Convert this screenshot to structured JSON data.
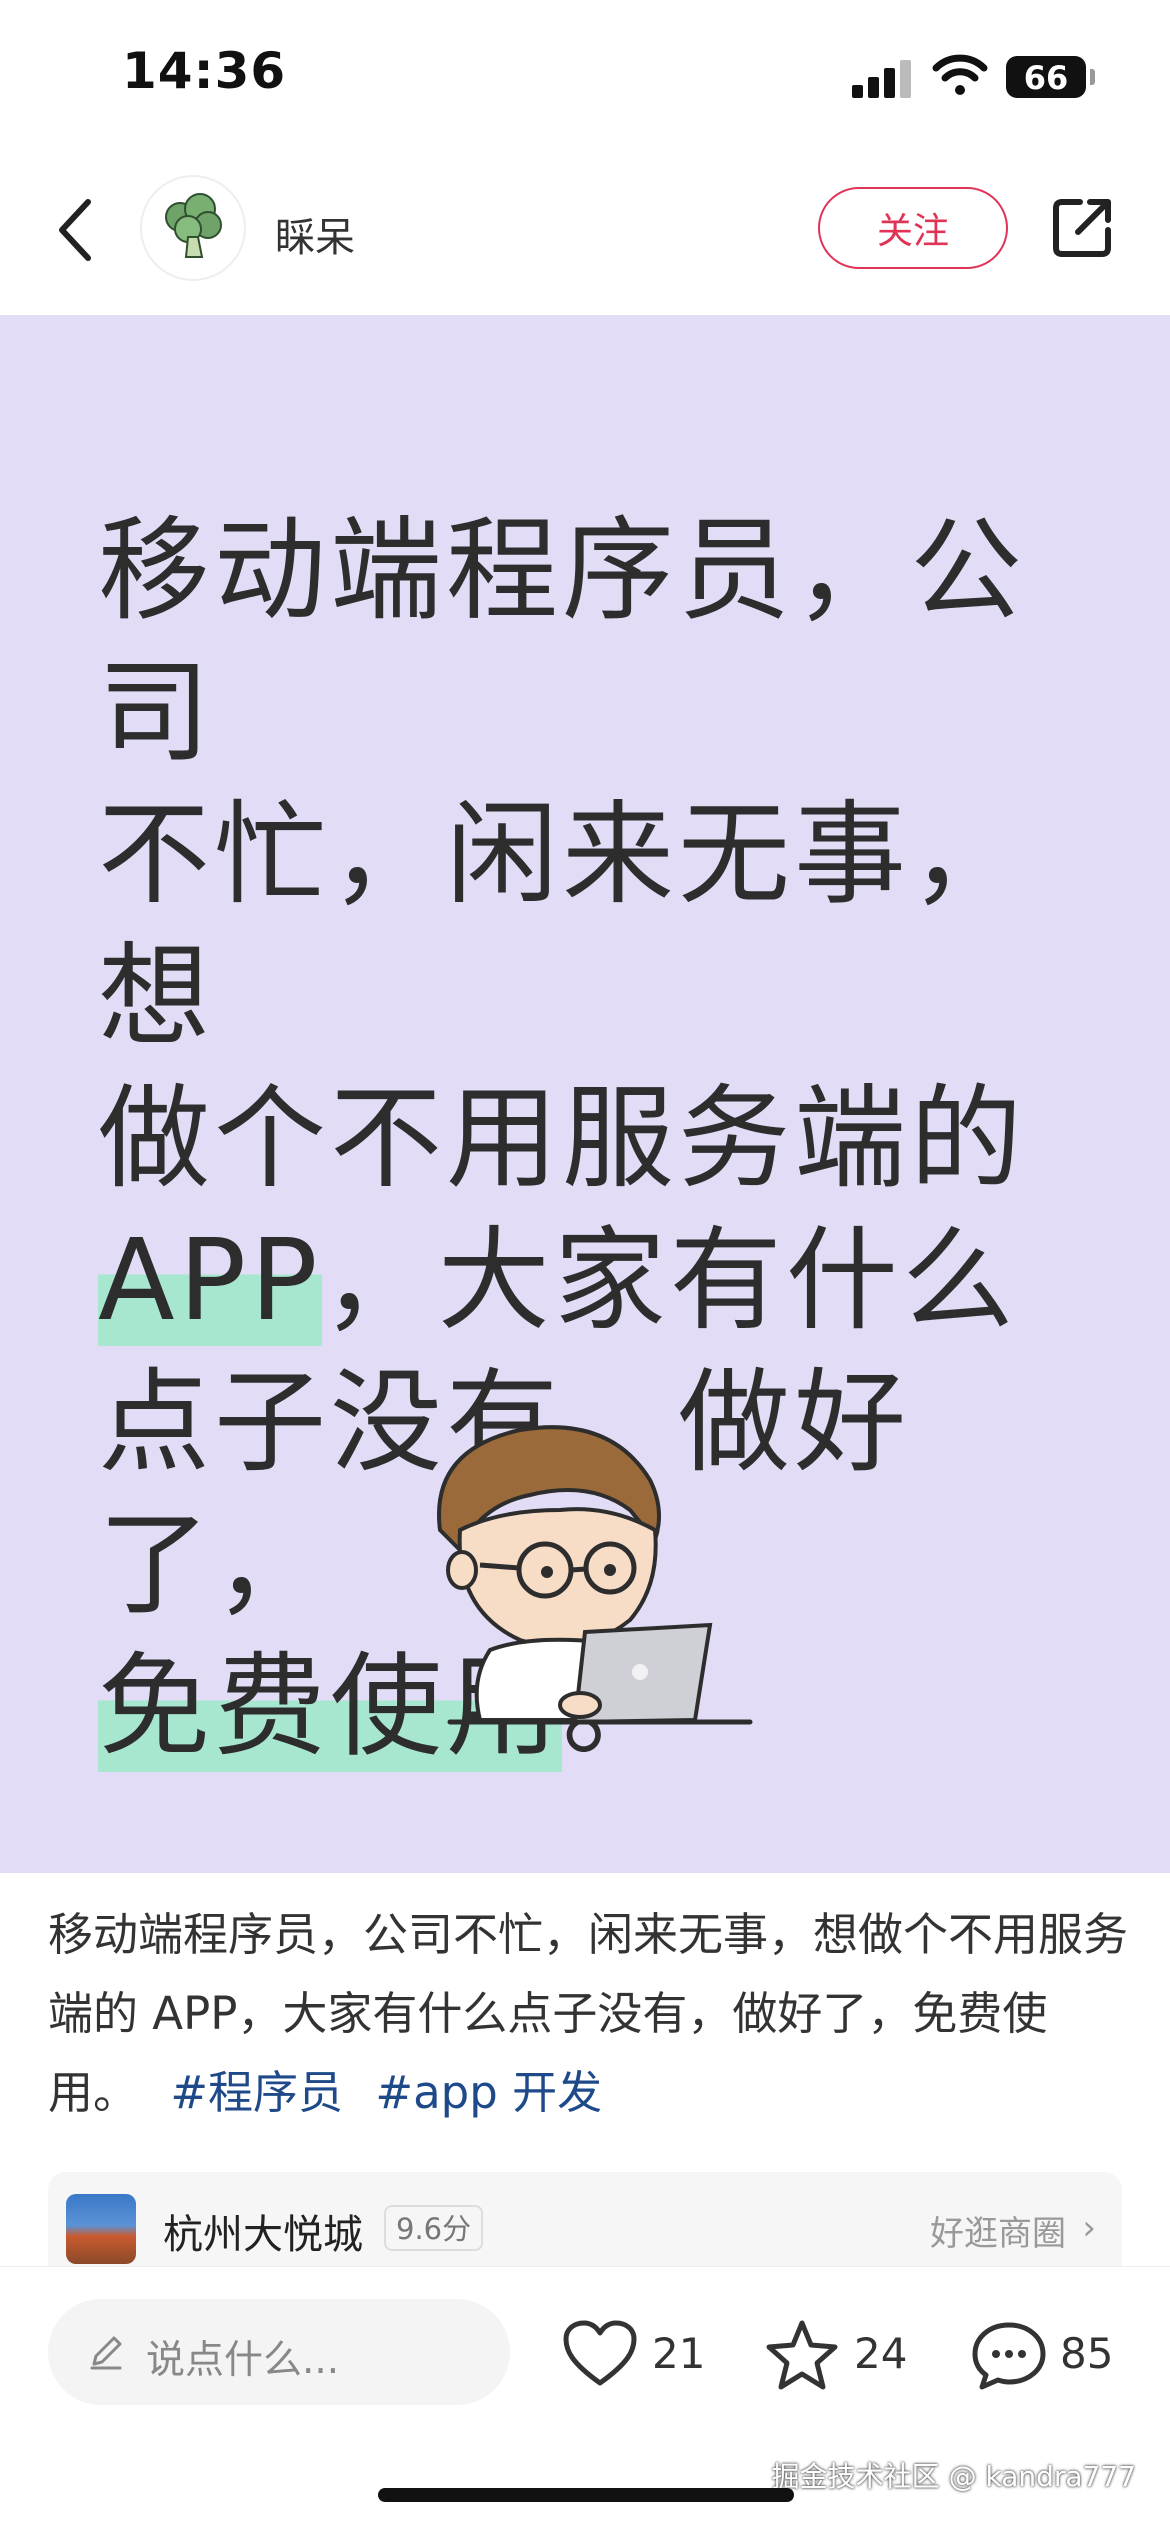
{
  "status_bar": {
    "time": "14:36",
    "battery": "66"
  },
  "header": {
    "author": "睬呆",
    "follow_label": "关注"
  },
  "hero": {
    "seg1": "移动端程序员，公司",
    "seg2": "不忙，闲来无事，想",
    "seg3": "做个不用服务端的",
    "seg4_hl": "APP",
    "seg4": "，大家有什么",
    "seg5": "点子没有，做好了，",
    "seg6_hl": "免费使用",
    "seg6": "。"
  },
  "caption": {
    "text": "移动端程序员，公司不忙，闲来无事，想做个不用服务端的 APP，大家有什么点子没有，做好了，免费使用。",
    "tags": [
      "#程序员",
      "#app 开发"
    ]
  },
  "location": {
    "name": "杭州大悦城",
    "score": "9.6分",
    "link": "好逛商圈"
  },
  "bottom": {
    "placeholder": "说点什么...",
    "likes": "21",
    "favorites": "24",
    "comments": "85"
  },
  "watermark": "掘金技术社区 @ kandra777"
}
